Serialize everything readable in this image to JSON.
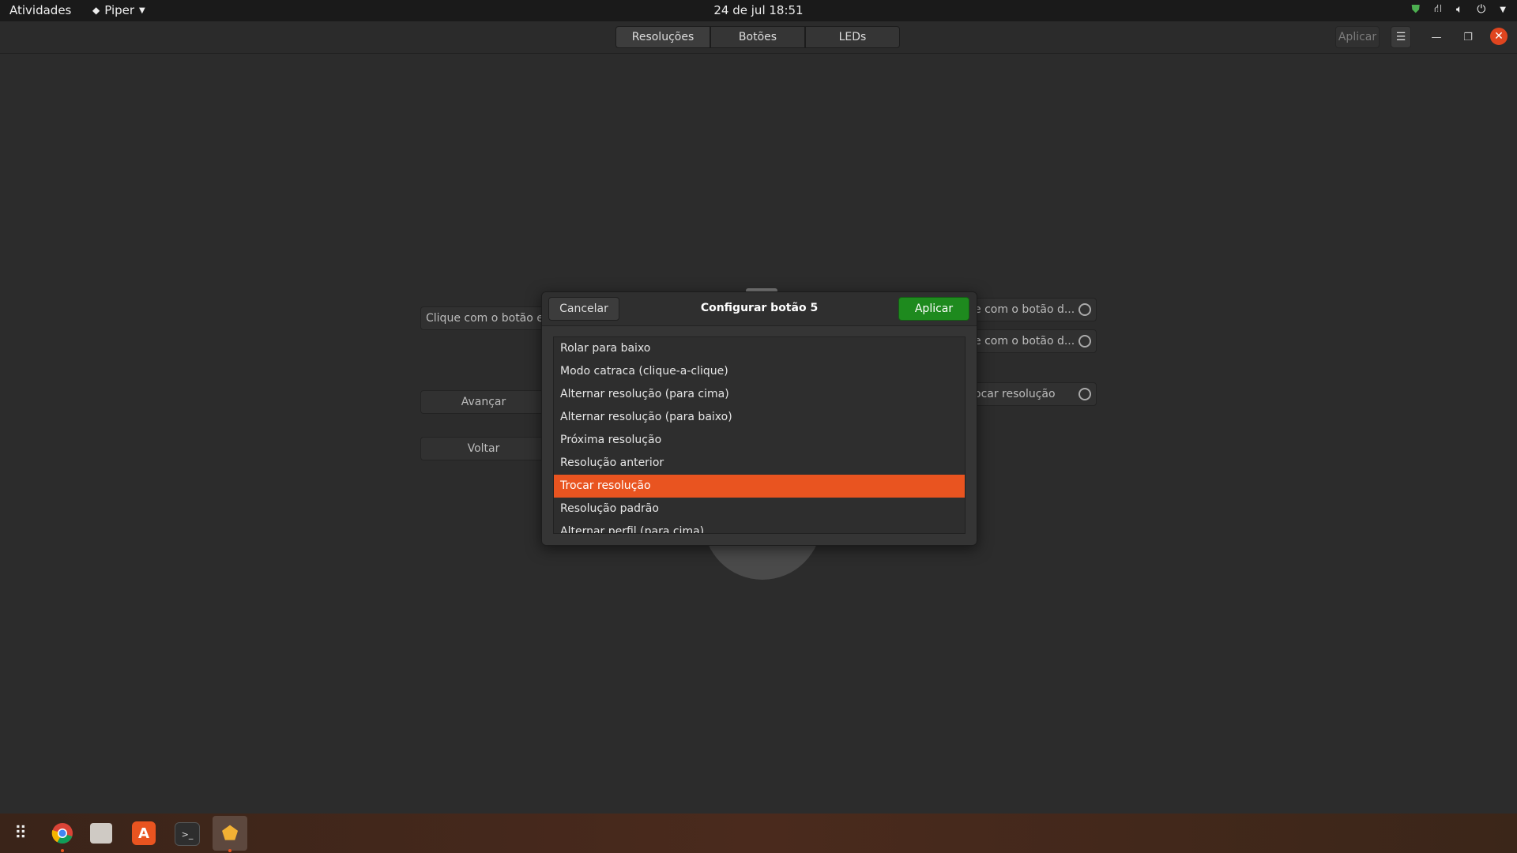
{
  "topbar": {
    "activities": "Atividades",
    "app_name": "Piper",
    "clock": "24 de jul  18:51"
  },
  "headerbar": {
    "tabs": [
      {
        "label": "Resoluções",
        "active": true
      },
      {
        "label": "Botões",
        "active": false
      },
      {
        "label": "LEDs",
        "active": false
      }
    ],
    "apply_label": "Aplicar"
  },
  "main": {
    "left_buttons": [
      {
        "label": "Clique com o botão e..."
      },
      {
        "label": "Avançar"
      },
      {
        "label": "Voltar"
      }
    ],
    "right_buttons": [
      {
        "label": "e com o botão d..."
      },
      {
        "label": "e com o botão d..."
      },
      {
        "label": "ocar resolução"
      }
    ]
  },
  "dialog": {
    "title": "Configurar botão 5",
    "cancel_label": "Cancelar",
    "apply_label": "Aplicar",
    "items": [
      "Rolar para baixo",
      "Modo catraca (clique-a-clique)",
      "Alternar resolução (para cima)",
      "Alternar resolução (para baixo)",
      "Próxima resolução",
      "Resolução anterior",
      "Trocar resolução",
      "Resolução padrão",
      "Alternar perfil (para cima)"
    ],
    "selected_index": 6
  },
  "colors": {
    "accent": "#e95420",
    "apply_green": "#1e8a1e",
    "background": "#2c2c2c"
  },
  "dock": {
    "icons": [
      "apps-grid-icon",
      "chrome-icon",
      "files-icon",
      "software-store-icon",
      "terminal-icon",
      "piper-icon"
    ]
  }
}
